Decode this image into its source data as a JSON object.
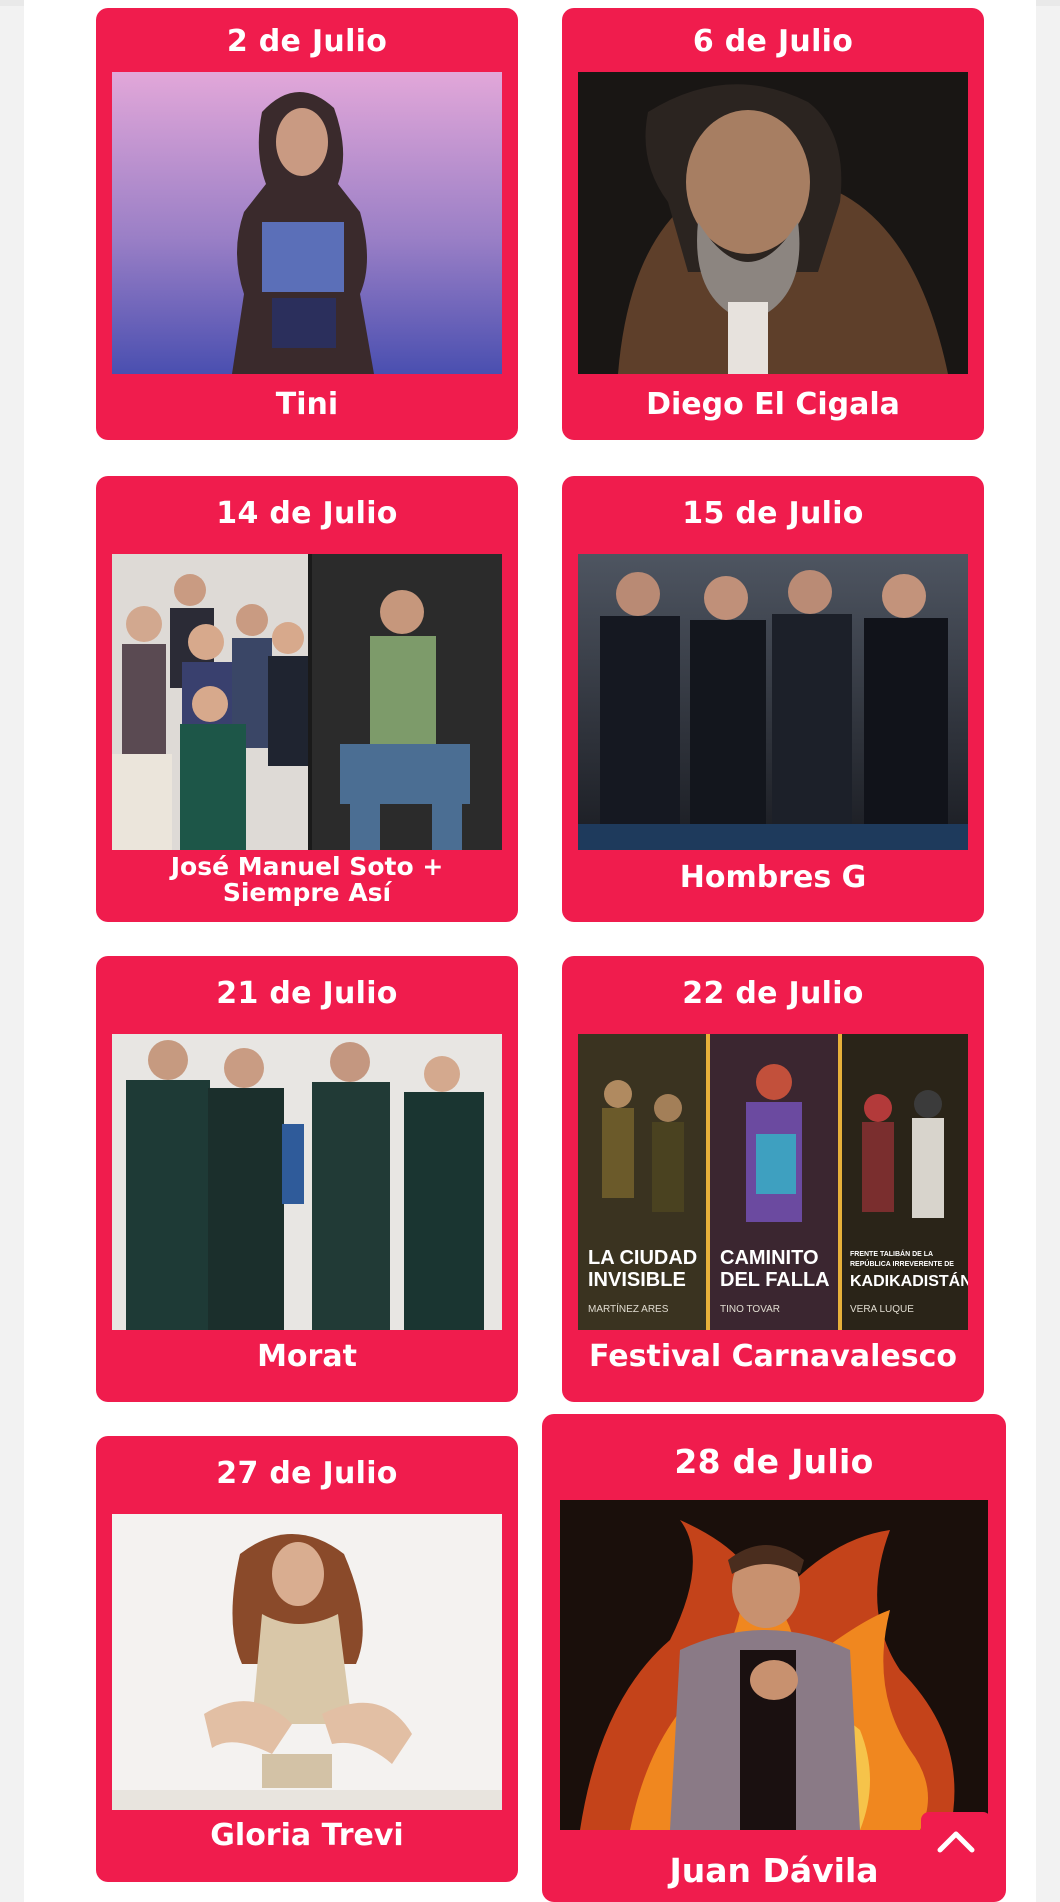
{
  "events": [
    {
      "date": "2 de Julio",
      "name": "Tini",
      "photo": "tini-photo"
    },
    {
      "date": "6 de Julio",
      "name": "Diego El Cigala",
      "photo": "diego-el-cigala-photo"
    },
    {
      "date": "14 de Julio",
      "name_line1": "José Manuel Soto +",
      "name_line2": "Siempre Así",
      "photo": "jose-manuel-soto-siempre-asi-photo"
    },
    {
      "date": "15 de Julio",
      "name": "Hombres G",
      "photo": "hombres-g-photo"
    },
    {
      "date": "21 de Julio",
      "name": "Morat",
      "photo": "morat-photo"
    },
    {
      "date": "22 de Julio",
      "name": "Festival Carnavalesco",
      "photo": "festival-carnavalesco-photo",
      "poster_panels": [
        {
          "title_line1": "LA CIUDAD",
          "title_line2": "INVISIBLE",
          "author": "MARTÍNEZ ARES"
        },
        {
          "title_line1": "CAMINITO",
          "title_line2": "DEL FALLA",
          "author": "TINO TOVAR"
        },
        {
          "subtitle_line1": "FRENTE TALIBÁN DE LA",
          "subtitle_line2": "REPÚBLICA IRREVERENTE DE",
          "title_line1": "KADIKADISTÁN",
          "author": "VERA LUQUE"
        }
      ]
    },
    {
      "date": "27 de Julio",
      "name": "Gloria Trevi",
      "photo": "gloria-trevi-photo"
    },
    {
      "date": "28 de Julio",
      "name": "Juan Dávila",
      "photo": "juan-davila-photo"
    }
  ],
  "back_to_top": {
    "icon": "chevron-up-icon"
  },
  "colors": {
    "card": "#f01c4d",
    "text": "#ffffff",
    "page": "#ffffff"
  }
}
